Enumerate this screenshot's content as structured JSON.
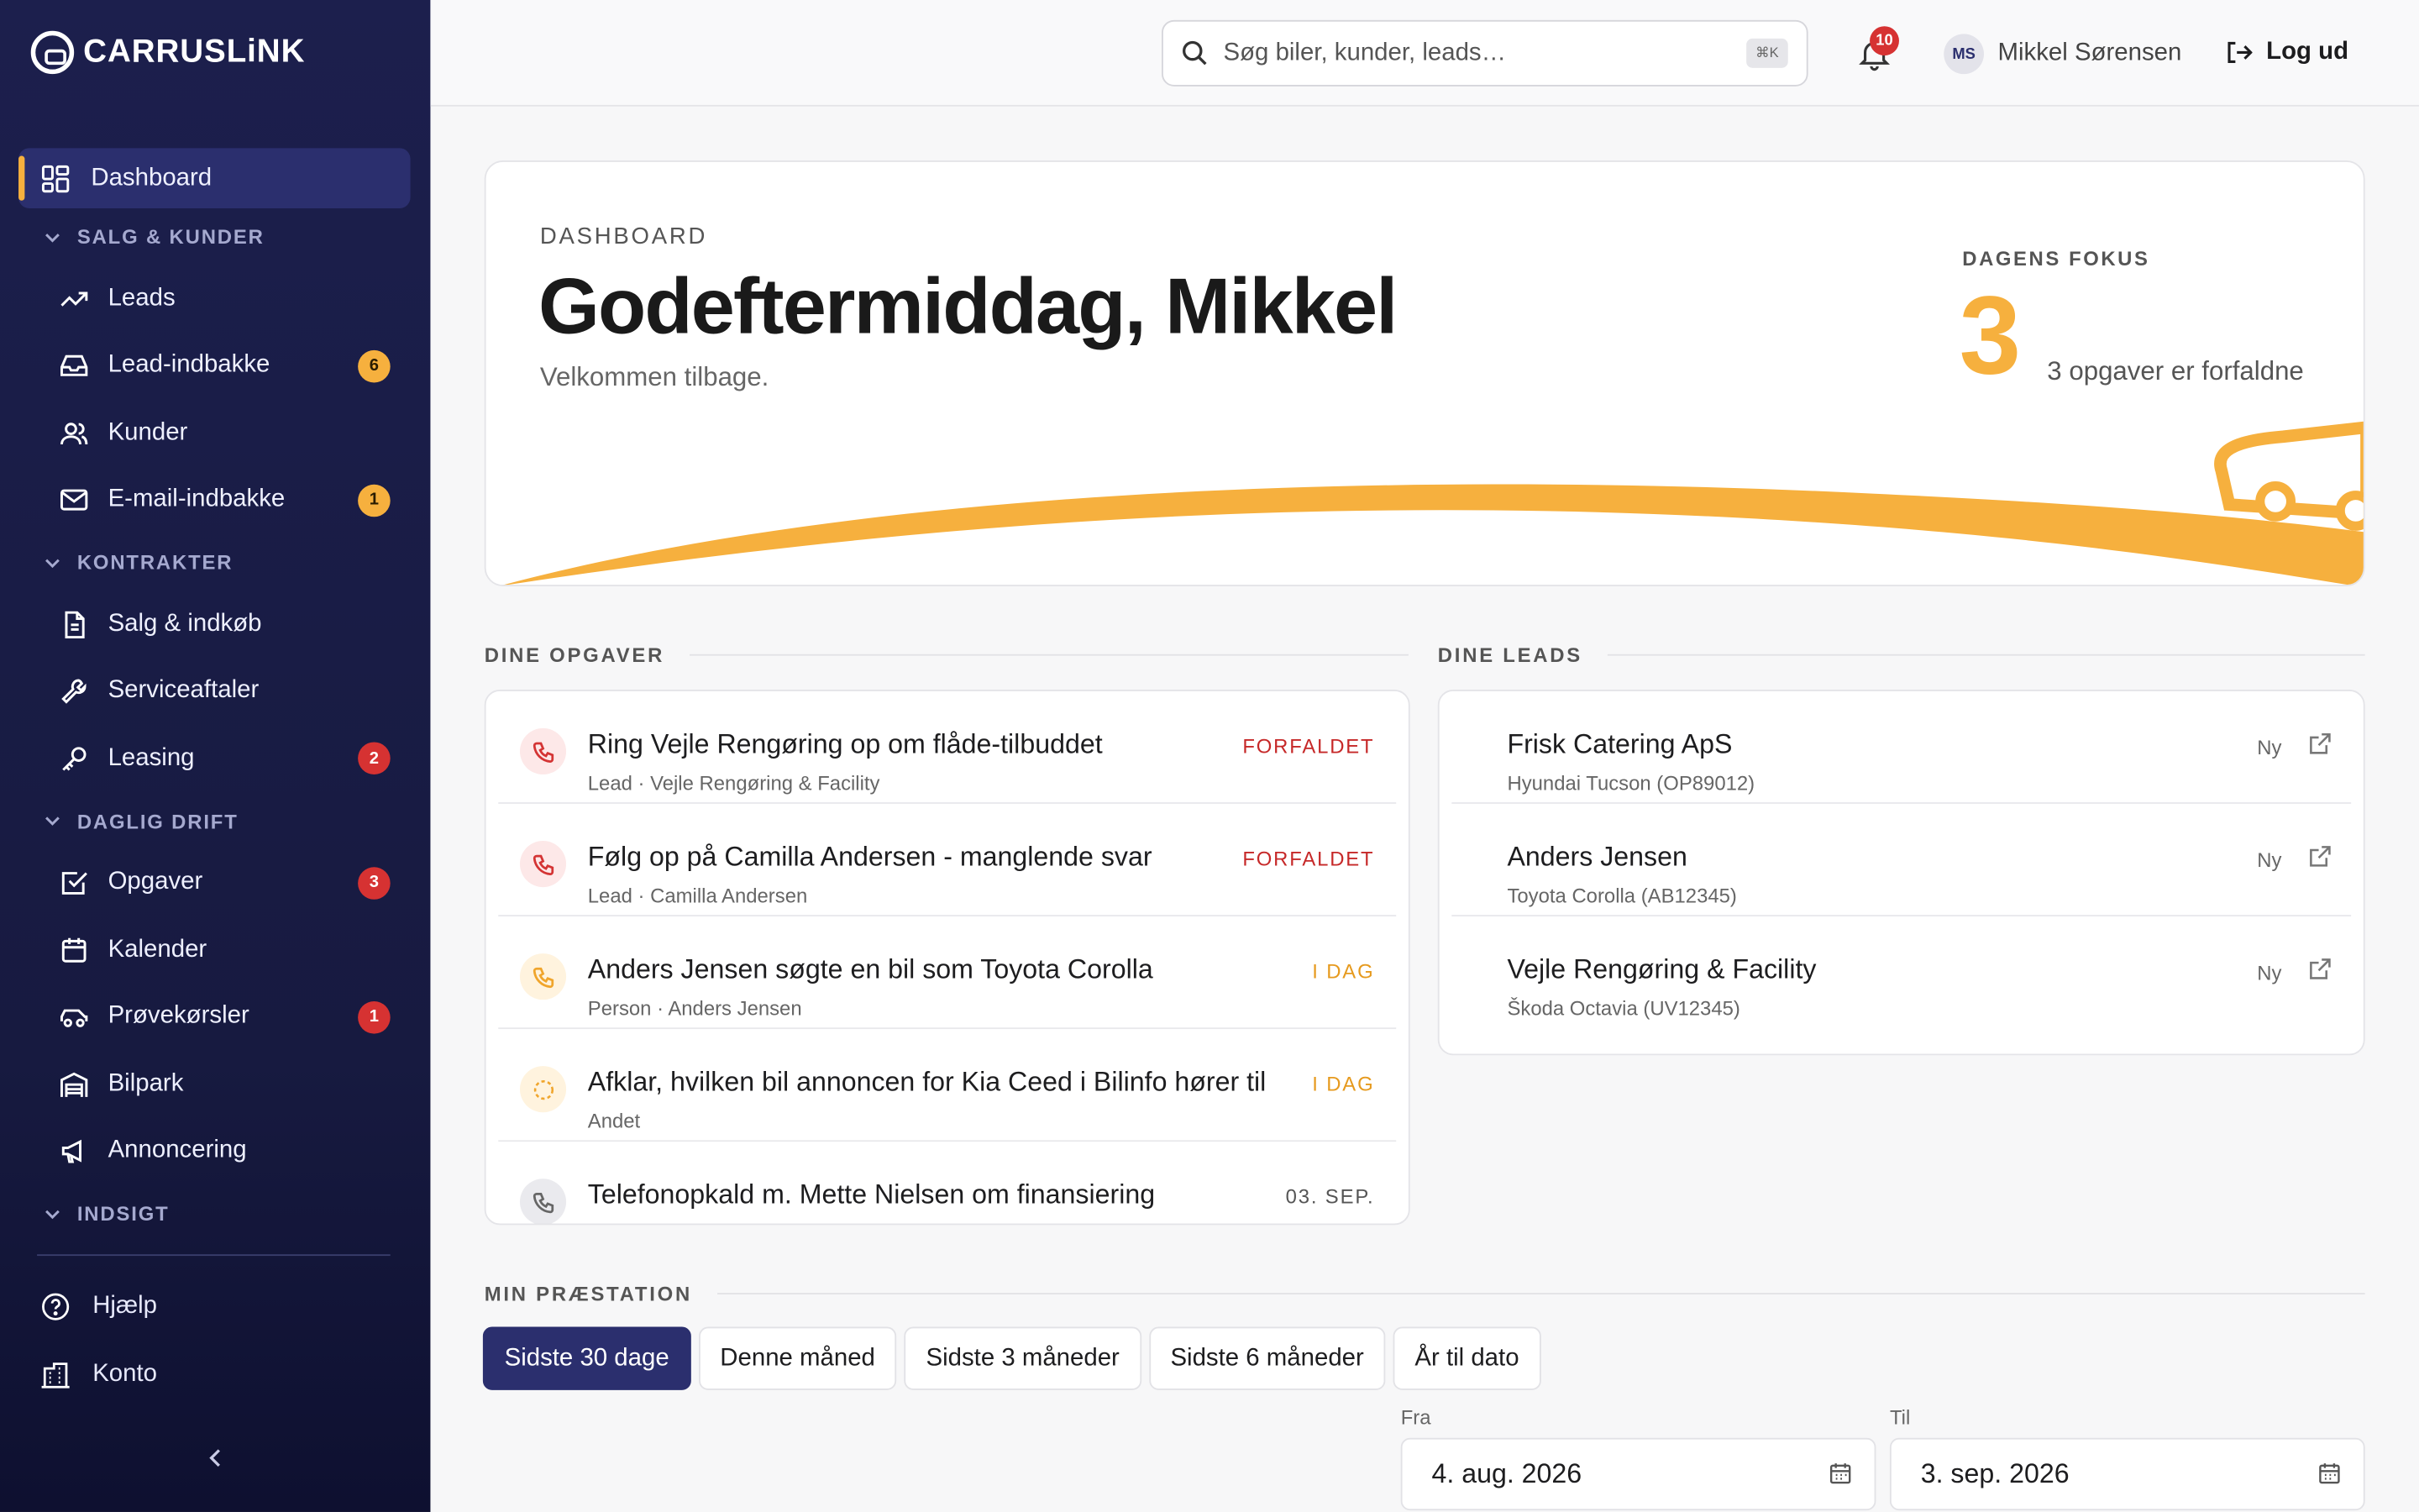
{
  "brand": {
    "logo_text": "CARRUSLiNK"
  },
  "colors": {
    "accent": "#f6b03e",
    "navy": "#2b2f6e",
    "danger": "#d63232"
  },
  "sidebar": {
    "dashboard": "Dashboard",
    "sections": {
      "salg": "SALG & KUNDER",
      "kontrakter": "KONTRAKTER",
      "drift": "DAGLIG DRIFT",
      "indsigt": "INDSIGT"
    },
    "items": {
      "leads": "Leads",
      "lead_inbox": "Lead-indbakke",
      "lead_inbox_count": "6",
      "kunder": "Kunder",
      "email_inbox": "E-mail-indbakke",
      "email_inbox_count": "1",
      "salg_indkob": "Salg & indkøb",
      "serviceaftaler": "Serviceaftaler",
      "leasing": "Leasing",
      "leasing_count": "2",
      "opgaver": "Opgaver",
      "opgaver_count": "3",
      "kalender": "Kalender",
      "provekorsler": "Prøvekørsler",
      "provekorsler_count": "1",
      "bilpark": "Bilpark",
      "annoncering": "Annoncering"
    },
    "footer": {
      "help": "Hjælp",
      "account": "Konto"
    }
  },
  "topbar": {
    "search_placeholder": "Søg biler, kunder, leads…",
    "shortcut": "⌘K",
    "notifications_count": "10",
    "avatar_initials": "MS",
    "user_name": "Mikkel Sørensen",
    "logout": "Log ud"
  },
  "hero": {
    "eyebrow": "DASHBOARD",
    "title": "Godeftermiddag, Mikkel",
    "subtitle": "Velkommen tilbage.",
    "focus_label": "DAGENS FOKUS",
    "focus_number": "3",
    "focus_text": "3 opgaver er forfaldne"
  },
  "tasks": {
    "heading": "DINE OPGAVER",
    "items": [
      {
        "title": "Ring Vejle Rengøring op om flåde-tilbuddet",
        "meta": "Lead · Vejle Rengøring & Facility",
        "status": "FORFALDET",
        "icon": "phone-icon"
      },
      {
        "title": "Følg op på Camilla Andersen - manglende svar",
        "meta": "Lead · Camilla Andersen",
        "status": "FORFALDET",
        "icon": "phone-icon"
      },
      {
        "title": "Anders Jensen søgte en bil som Toyota Corolla",
        "meta": "Person · Anders Jensen",
        "status": "I DAG",
        "icon": "phone-icon"
      },
      {
        "title": "Afklar, hvilken bil annoncen for Kia Ceed i Bilinfo hører til",
        "meta": "Andet",
        "status": "I DAG",
        "icon": "dashed-circle-icon"
      },
      {
        "title": "Telefonopkald m. Mette Nielsen om finansiering",
        "meta": "",
        "status": "03. SEP.",
        "icon": "phone-icon"
      }
    ]
  },
  "leads": {
    "heading": "DINE LEADS",
    "items": [
      {
        "title": "Frisk Catering ApS",
        "meta": "Hyundai Tucson (OP89012)",
        "status": "Ny"
      },
      {
        "title": "Anders Jensen",
        "meta": "Toyota Corolla (AB12345)",
        "status": "Ny"
      },
      {
        "title": "Vejle Rengøring & Facility",
        "meta": "Škoda Octavia (UV12345)",
        "status": "Ny"
      }
    ]
  },
  "performance": {
    "heading": "MIN PRÆSTATION",
    "tabs": [
      "Sidste 30 dage",
      "Denne måned",
      "Sidste 3 måneder",
      "Sidste 6 måneder",
      "År til dato"
    ],
    "from_label": "Fra",
    "from_value": "4. aug. 2026",
    "to_label": "Til",
    "to_value": "3. sep. 2026"
  }
}
